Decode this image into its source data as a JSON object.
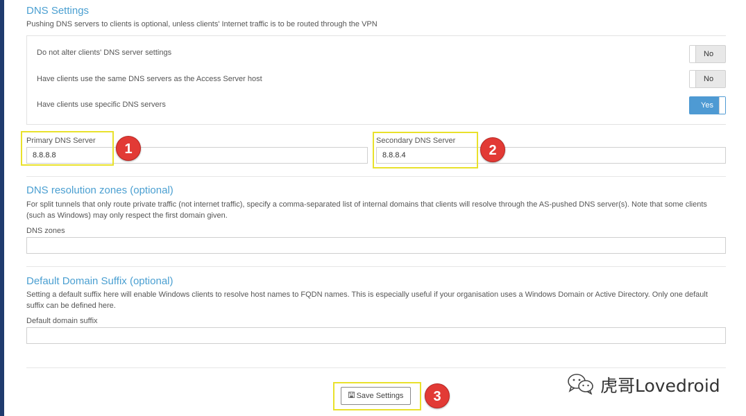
{
  "dns_settings": {
    "title": "DNS Settings",
    "description": "Pushing DNS servers to clients is optional, unless clients' Internet traffic is to be routed through the VPN",
    "options": [
      {
        "label": "Do not alter clients' DNS server settings",
        "value": "No"
      },
      {
        "label": "Have clients use the same DNS servers as the Access Server host",
        "value": "No"
      },
      {
        "label": "Have clients use specific DNS servers",
        "value": "Yes"
      }
    ],
    "primary": {
      "label": "Primary DNS Server",
      "value": "8.8.8.8"
    },
    "secondary": {
      "label": "Secondary DNS Server",
      "value": "8.8.8.4"
    }
  },
  "resolution_zones": {
    "title": "DNS resolution zones (optional)",
    "description": "For split tunnels that only route private traffic (not internet traffic), specify a comma-separated list of internal domains that clients will resolve through the AS-pushed DNS server(s). Note that some clients (such as Windows) may only respect the first domain given.",
    "field_label": "DNS zones",
    "value": ""
  },
  "domain_suffix": {
    "title": "Default Domain Suffix (optional)",
    "description": "Setting a default suffix here will enable Windows clients to resolve host names to FQDN names. This is especially useful if your organisation uses a Windows Domain or Active Directory. Only one default suffix can be defined here.",
    "field_label": "Default domain suffix",
    "value": ""
  },
  "save_button": {
    "label": "Save Settings",
    "icon": "floppy-disk-icon"
  },
  "annotations": [
    "1",
    "2",
    "3"
  ],
  "watermark": {
    "text": "虎哥Lovedroid",
    "icon": "wechat-icon"
  },
  "colors": {
    "accent": "#4a9fd1",
    "toggle_on": "#4e9ad3",
    "highlight": "#e9e12b",
    "badge": "#e23a35",
    "left_bar": "#1f3b6e"
  }
}
